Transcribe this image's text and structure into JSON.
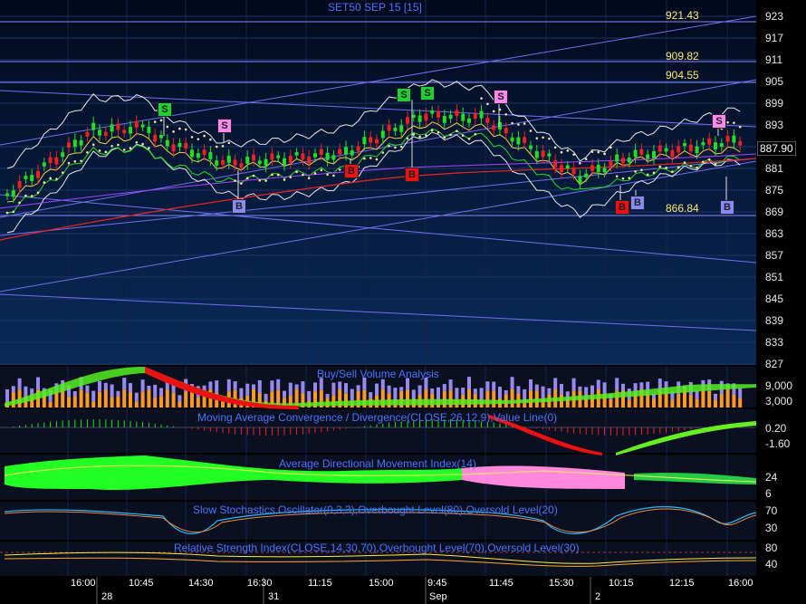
{
  "main": {
    "title": "SET50 SEP 15   [15]",
    "current_price": "887.90",
    "price_axis": [
      "923",
      "917",
      "911",
      "905",
      "899",
      "893",
      "887",
      "881",
      "875",
      "869",
      "863",
      "857",
      "851",
      "845",
      "839",
      "833",
      "827"
    ],
    "levels": [
      "921.43",
      "909.82",
      "904.55",
      "866.84"
    ],
    "signals": [
      {
        "text": "S",
        "kind": "sg"
      },
      {
        "text": "S",
        "kind": "s"
      },
      {
        "text": "B",
        "kind": "b"
      },
      {
        "text": "B",
        "kind": "br"
      },
      {
        "text": "S",
        "kind": "sg"
      },
      {
        "text": "S",
        "kind": "sg"
      },
      {
        "text": "B",
        "kind": "br"
      },
      {
        "text": "S",
        "kind": "s"
      },
      {
        "text": "B",
        "kind": "br"
      },
      {
        "text": "B",
        "kind": "b"
      },
      {
        "text": "S",
        "kind": "s"
      },
      {
        "text": "B",
        "kind": "b"
      }
    ]
  },
  "volume": {
    "title": "Buy/Sell Volume Analysis",
    "axis": [
      "9,000",
      "3,000"
    ]
  },
  "macd": {
    "title": "Moving Average Convergence / Divergence(CLOSE,26,12,9),Value Line(0)",
    "axis": [
      "0.20",
      "-1.60"
    ]
  },
  "adx": {
    "title": "Average Directional Movement Index(14)",
    "axis": [
      "24",
      "6"
    ]
  },
  "stoch": {
    "title": "Slow Stochastics Oscillator(9,3,3),Overbought Level(80),Oversold Level(20)",
    "axis": [
      "70",
      "30"
    ]
  },
  "rsi": {
    "title": "Relative Strength Index(CLOSE,14,30,70),Overbought Level(70),Oversold Level(30)",
    "axis": [
      "80",
      "40"
    ]
  },
  "time_axis": {
    "times": [
      "16:00",
      "10:45",
      "14:30",
      "16:30",
      "11:15",
      "15:00",
      "9:45",
      "11:45",
      "15:30",
      "10:15",
      "12:15",
      "16:00"
    ],
    "dates": [
      "28",
      "31",
      "Sep",
      "2"
    ]
  },
  "colors": {
    "accent": "#4a72ff",
    "bull": "#22dd22",
    "bear": "#ee2222",
    "level": "#ffe870",
    "up_signal": "#22cc33",
    "down_signal": "#ff88ee"
  }
}
